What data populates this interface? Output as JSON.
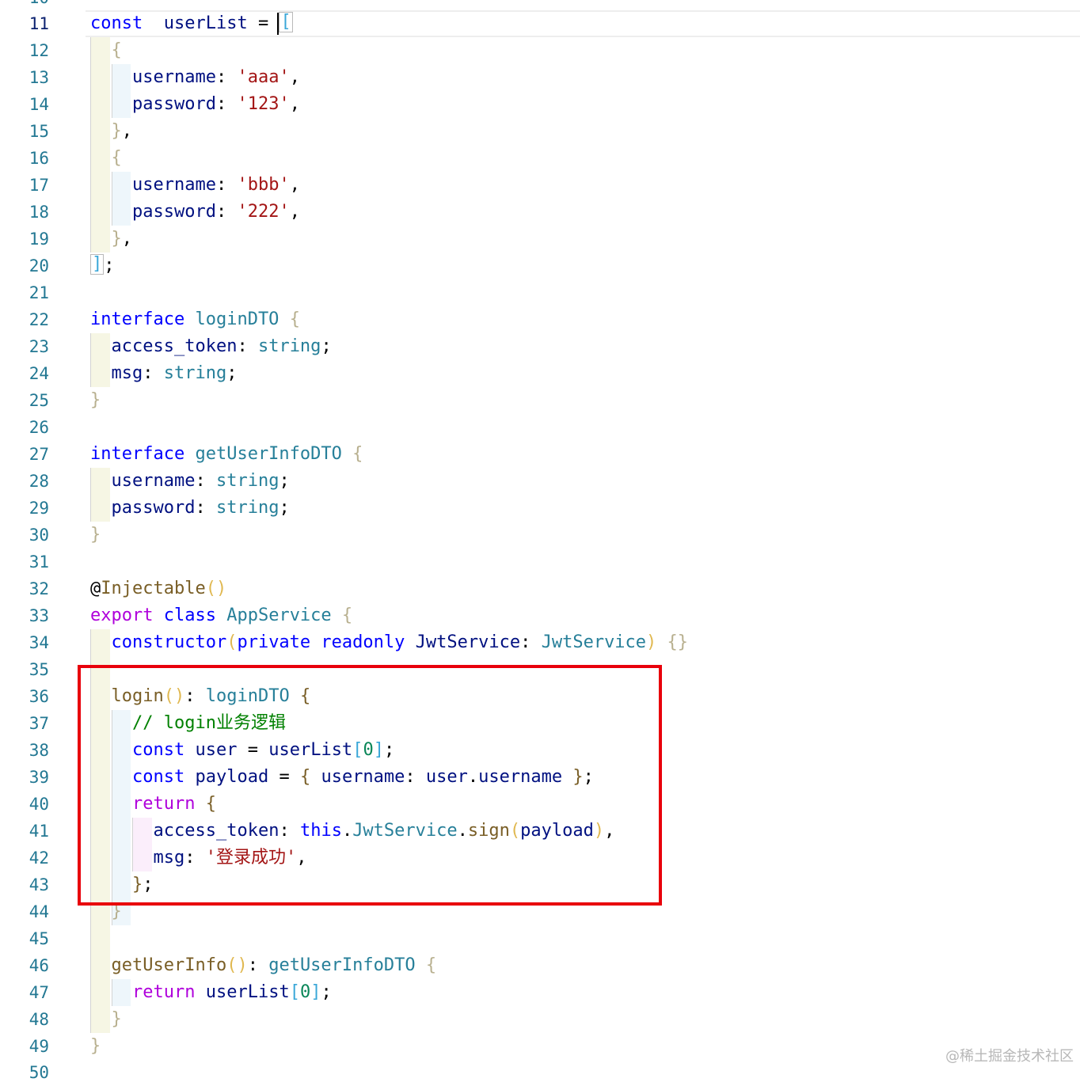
{
  "editor": {
    "partial_top_line": "10",
    "partial_bottom_line": "50",
    "lines": [
      {
        "n": "11",
        "t": [
          [
            "kw",
            "const"
          ],
          [
            "",
            "  "
          ],
          [
            "var",
            "userList"
          ],
          [
            "",
            " = "
          ],
          [
            "b2box",
            "["
          ]
        ]
      },
      {
        "n": "12",
        "t": [
          [
            "",
            ""
          ],
          [
            "b1",
            "{"
          ]
        ]
      },
      {
        "n": "13",
        "t": [
          [
            "var",
            "username"
          ],
          [
            "",
            ": "
          ],
          [
            "str",
            "'aaa'"
          ],
          [
            "",
            ","
          ]
        ]
      },
      {
        "n": "14",
        "t": [
          [
            "var",
            "password"
          ],
          [
            "",
            ": "
          ],
          [
            "str",
            "'123'"
          ],
          [
            "",
            ","
          ]
        ]
      },
      {
        "n": "15",
        "t": [
          [
            "b1",
            "}"
          ],
          [
            "",
            ","
          ]
        ]
      },
      {
        "n": "16",
        "t": [
          [
            "b1",
            "{"
          ]
        ]
      },
      {
        "n": "17",
        "t": [
          [
            "var",
            "username"
          ],
          [
            "",
            ": "
          ],
          [
            "str",
            "'bbb'"
          ],
          [
            "",
            ","
          ]
        ]
      },
      {
        "n": "18",
        "t": [
          [
            "var",
            "password"
          ],
          [
            "",
            ": "
          ],
          [
            "str",
            "'222'"
          ],
          [
            "",
            ","
          ]
        ]
      },
      {
        "n": "19",
        "t": [
          [
            "b1",
            "}"
          ],
          [
            "",
            ","
          ]
        ]
      },
      {
        "n": "20",
        "t": [
          [
            "b2box",
            "]"
          ],
          [
            "",
            ";"
          ]
        ]
      },
      {
        "n": "21",
        "t": []
      },
      {
        "n": "22",
        "t": [
          [
            "kw",
            "interface"
          ],
          [
            "",
            " "
          ],
          [
            "type",
            "loginDTO"
          ],
          [
            "",
            " "
          ],
          [
            "b1",
            "{"
          ]
        ]
      },
      {
        "n": "23",
        "t": [
          [
            "var",
            "access_token"
          ],
          [
            "",
            ": "
          ],
          [
            "type",
            "string"
          ],
          [
            "",
            ";"
          ]
        ]
      },
      {
        "n": "24",
        "t": [
          [
            "var",
            "msg"
          ],
          [
            "",
            ": "
          ],
          [
            "type",
            "string"
          ],
          [
            "",
            ";"
          ]
        ]
      },
      {
        "n": "25",
        "t": [
          [
            "b1",
            "}"
          ]
        ]
      },
      {
        "n": "26",
        "t": []
      },
      {
        "n": "27",
        "t": [
          [
            "kw",
            "interface"
          ],
          [
            "",
            " "
          ],
          [
            "type",
            "getUserInfoDTO"
          ],
          [
            "",
            " "
          ],
          [
            "b1",
            "{"
          ]
        ]
      },
      {
        "n": "28",
        "t": [
          [
            "var",
            "username"
          ],
          [
            "",
            ": "
          ],
          [
            "type",
            "string"
          ],
          [
            "",
            ";"
          ]
        ]
      },
      {
        "n": "29",
        "t": [
          [
            "var",
            "password"
          ],
          [
            "",
            ": "
          ],
          [
            "type",
            "string"
          ],
          [
            "",
            ";"
          ]
        ]
      },
      {
        "n": "30",
        "t": [
          [
            "b1",
            "}"
          ]
        ]
      },
      {
        "n": "31",
        "t": []
      },
      {
        "n": "32",
        "t": [
          [
            "",
            "@"
          ],
          [
            "fn",
            "Injectable"
          ],
          [
            "b3",
            "()"
          ]
        ]
      },
      {
        "n": "33",
        "t": [
          [
            "ctl",
            "export"
          ],
          [
            "",
            " "
          ],
          [
            "kw",
            "class"
          ],
          [
            "",
            " "
          ],
          [
            "type",
            "AppService"
          ],
          [
            "",
            " "
          ],
          [
            "b1",
            "{"
          ]
        ]
      },
      {
        "n": "34",
        "t": [
          [
            "kw",
            "constructor"
          ],
          [
            "b3",
            "("
          ],
          [
            "kw",
            "private"
          ],
          [
            "",
            " "
          ],
          [
            "kw",
            "readonly"
          ],
          [
            "",
            " "
          ],
          [
            "var",
            "JwtService"
          ],
          [
            "",
            ": "
          ],
          [
            "type",
            "JwtService"
          ],
          [
            "b3",
            ")"
          ],
          [
            "",
            " "
          ],
          [
            "b1",
            "{}"
          ]
        ]
      },
      {
        "n": "35",
        "t": []
      },
      {
        "n": "36",
        "t": [
          [
            "fn",
            "login"
          ],
          [
            "b3",
            "()"
          ],
          [
            "",
            ": "
          ],
          [
            "type",
            "loginDTO"
          ],
          [
            "",
            " "
          ],
          [
            "fn",
            "{"
          ]
        ]
      },
      {
        "n": "37",
        "t": [
          [
            "cmt",
            "// login业务逻辑"
          ]
        ]
      },
      {
        "n": "38",
        "t": [
          [
            "kw",
            "const"
          ],
          [
            "",
            " "
          ],
          [
            "var",
            "user"
          ],
          [
            "",
            " = "
          ],
          [
            "var",
            "userList"
          ],
          [
            "b2",
            "["
          ],
          [
            "num",
            "0"
          ],
          [
            "b2",
            "]"
          ],
          [
            "",
            ";"
          ]
        ]
      },
      {
        "n": "39",
        "t": [
          [
            "kw",
            "const"
          ],
          [
            "",
            " "
          ],
          [
            "var",
            "payload"
          ],
          [
            "",
            " = "
          ],
          [
            "fn",
            "{"
          ],
          [
            "",
            " "
          ],
          [
            "var",
            "username"
          ],
          [
            "",
            ": "
          ],
          [
            "var",
            "user"
          ],
          [
            "",
            "."
          ],
          [
            "var",
            "username"
          ],
          [
            "",
            " "
          ],
          [
            "fn",
            "}"
          ],
          [
            "",
            ";"
          ]
        ]
      },
      {
        "n": "40",
        "t": [
          [
            "ctl",
            "return"
          ],
          [
            "",
            " "
          ],
          [
            "fn",
            "{"
          ]
        ]
      },
      {
        "n": "41",
        "t": [
          [
            "var",
            "access_token"
          ],
          [
            "",
            ": "
          ],
          [
            "kw",
            "this"
          ],
          [
            "",
            "."
          ],
          [
            "type",
            "JwtService"
          ],
          [
            "",
            "."
          ],
          [
            "fn",
            "sign"
          ],
          [
            "b3",
            "("
          ],
          [
            "var",
            "payload"
          ],
          [
            "b3",
            ")"
          ],
          [
            "",
            ","
          ]
        ]
      },
      {
        "n": "42",
        "t": [
          [
            "var",
            "msg"
          ],
          [
            "",
            ": "
          ],
          [
            "str",
            "'登录成功'"
          ],
          [
            "",
            ","
          ]
        ]
      },
      {
        "n": "43",
        "t": [
          [
            "fn",
            "}"
          ],
          [
            "",
            ";"
          ]
        ]
      },
      {
        "n": "44",
        "t": [
          [
            "b1",
            "}"
          ]
        ]
      },
      {
        "n": "45",
        "t": []
      },
      {
        "n": "46",
        "t": [
          [
            "fn",
            "getUserInfo"
          ],
          [
            "b3",
            "()"
          ],
          [
            "",
            ": "
          ],
          [
            "type",
            "getUserInfoDTO"
          ],
          [
            "",
            " "
          ],
          [
            "b1",
            "{"
          ]
        ]
      },
      {
        "n": "47",
        "t": [
          [
            "ctl",
            "return"
          ],
          [
            "",
            " "
          ],
          [
            "var",
            "userList"
          ],
          [
            "b2",
            "["
          ],
          [
            "num",
            "0"
          ],
          [
            "b2",
            "]"
          ],
          [
            "",
            ";"
          ]
        ]
      },
      {
        "n": "48",
        "t": [
          [
            "b1",
            "}"
          ]
        ]
      },
      {
        "n": "49",
        "t": [
          [
            "b1",
            "}"
          ]
        ]
      }
    ]
  },
  "watermark": "@稀土掘金技术社区",
  "colors": {
    "highlight_border": "#e8000b",
    "line_number": "#237893",
    "keyword": "#0000ff",
    "string": "#a31515",
    "comment": "#008000"
  }
}
